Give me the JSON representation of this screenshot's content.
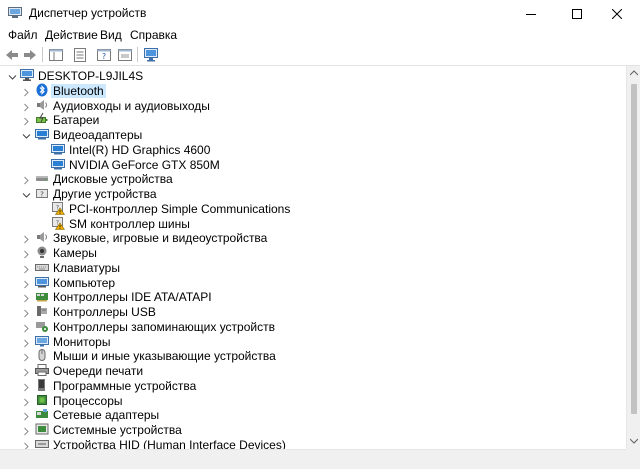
{
  "window": {
    "title": "Диспетчер устройств",
    "controls": [
      "minimize-icon",
      "maximize-icon",
      "close-icon"
    ]
  },
  "menu": [
    "Файл",
    "Действие",
    "Вид",
    "Справка"
  ],
  "toolbar": {
    "buttons": [
      "back-arrow-icon",
      "forward-arrow-icon",
      "show-hide-tree-icon",
      "properties-icon",
      "help-icon",
      "scan-hardware-icon"
    ]
  },
  "tree": {
    "root": "DESKTOP-L9JIL4S",
    "nodes": [
      {
        "label": "Bluetooth",
        "icon": "bluetooth-icon",
        "expanded": false,
        "selected": true
      },
      {
        "label": "Аудиовходы и аудиовыходы",
        "icon": "speaker-icon",
        "expanded": false
      },
      {
        "label": "Батареи",
        "icon": "battery-icon",
        "expanded": false
      },
      {
        "label": "Видеоадаптеры",
        "icon": "display-adapter-icon",
        "expanded": true,
        "children": [
          {
            "label": "Intel(R) HD Graphics 4600",
            "icon": "display-adapter-icon"
          },
          {
            "label": "NVIDIA GeForce GTX 850M",
            "icon": "display-adapter-icon"
          }
        ]
      },
      {
        "label": "Дисковые устройства",
        "icon": "disk-drive-icon",
        "expanded": false
      },
      {
        "label": "Другие устройства",
        "icon": "unknown-device-icon",
        "expanded": true,
        "children": [
          {
            "label": "PCI-контроллер Simple Communications",
            "icon": "warning-device-icon"
          },
          {
            "label": "SM контроллер шины",
            "icon": "warning-device-icon"
          }
        ]
      },
      {
        "label": "Звуковые, игровые и видеоустройства",
        "icon": "speaker-icon",
        "expanded": false
      },
      {
        "label": "Камеры",
        "icon": "camera-icon",
        "expanded": false
      },
      {
        "label": "Клавиатуры",
        "icon": "keyboard-icon",
        "expanded": false
      },
      {
        "label": "Компьютер",
        "icon": "computer-icon",
        "expanded": false
      },
      {
        "label": "Контроллеры IDE ATA/ATAPI",
        "icon": "ide-controller-icon",
        "expanded": false
      },
      {
        "label": "Контроллеры USB",
        "icon": "usb-icon",
        "expanded": false
      },
      {
        "label": "Контроллеры запоминающих устройств",
        "icon": "storage-controller-icon",
        "expanded": false
      },
      {
        "label": "Мониторы",
        "icon": "monitor-icon",
        "expanded": false
      },
      {
        "label": "Мыши и иные указывающие устройства",
        "icon": "mouse-icon",
        "expanded": false
      },
      {
        "label": "Очереди печати",
        "icon": "printer-icon",
        "expanded": false
      },
      {
        "label": "Программные устройства",
        "icon": "software-device-icon",
        "expanded": false
      },
      {
        "label": "Процессоры",
        "icon": "processor-icon",
        "expanded": false
      },
      {
        "label": "Сетевые адаптеры",
        "icon": "network-adapter-icon",
        "expanded": false
      },
      {
        "label": "Системные устройства",
        "icon": "system-device-icon",
        "expanded": false
      },
      {
        "label": "Устройства HID (Human Interface Devices)",
        "icon": "hid-icon",
        "expanded": false
      }
    ]
  },
  "colors": {
    "selection": "#cce8ff",
    "accent": "#0078d7",
    "monitor_blue": "#2a7fd4",
    "warning": "#f2b300"
  }
}
